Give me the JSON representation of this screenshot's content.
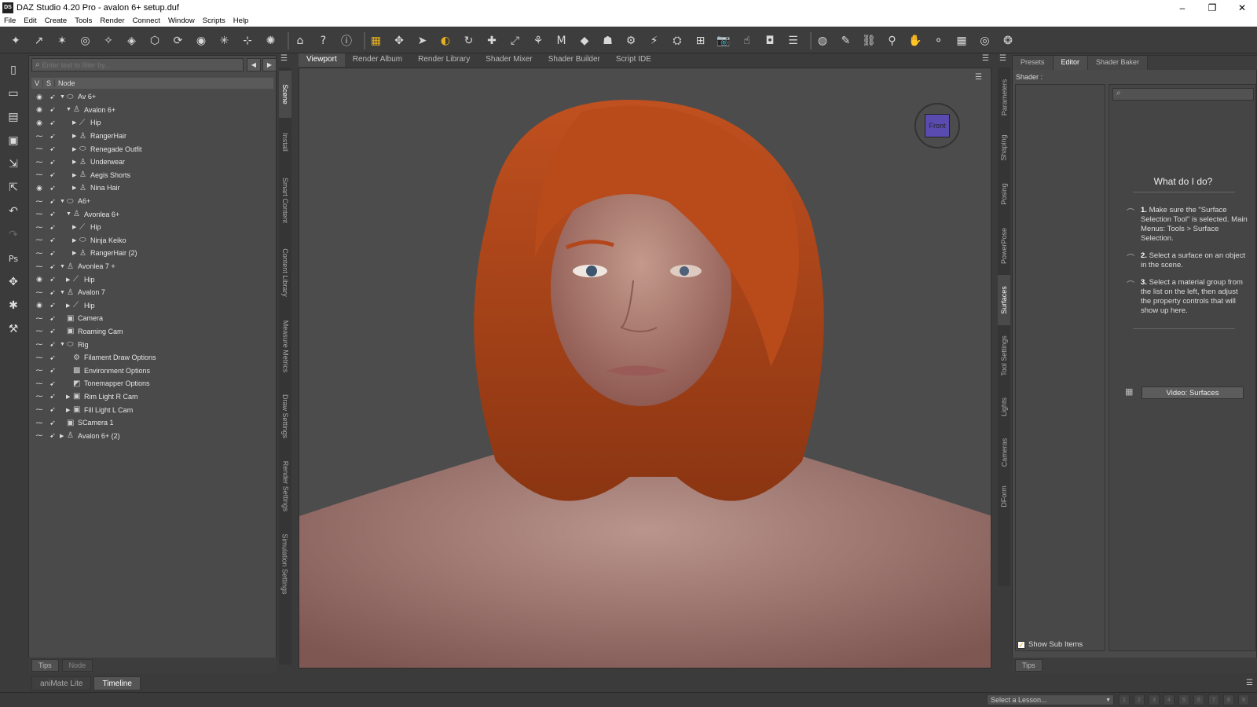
{
  "window": {
    "title": "DAZ Studio 4.20 Pro - avalon 6+ setup.duf",
    "app_badge": "DS",
    "minimize": "–",
    "restore": "❐",
    "close": "✕"
  },
  "menu": [
    "File",
    "Edit",
    "Create",
    "Tools",
    "Render",
    "Connect",
    "Window",
    "Scripts",
    "Help"
  ],
  "toolbar": {
    "icons": [
      "new-figure-icon",
      "joint-editor-icon",
      "node-weight-icon",
      "surface-selection-icon",
      "geometry-editor-icon",
      "move-tool-icon",
      "rotate-tool-icon",
      "scale-tool-icon",
      "universal-tool-icon",
      "node-selection-icon",
      "active-pose-icon",
      "weight-map-icon",
      "ds-logo-icon",
      "whats-this-icon",
      "help-icon",
      "spot-render-icon",
      "universal-manipulator-icon",
      "selection-arrow-icon",
      "pose-tool-icon",
      "rotate-icon",
      "translate-icon",
      "scale-icon",
      "transform-icon",
      "region-navigator-icon",
      "geometry-icon",
      "node-icon",
      "bone-icon",
      "erase-icon",
      "smooth-icon",
      "paint-icon",
      "camera-icon",
      "pointer-icon",
      "render-icon",
      "align-icon",
      "loop-icon",
      "brush-icon",
      "link-icon",
      "pin-icon",
      "hand-icon",
      "grab-icon",
      "grid-icon",
      "globe-icon",
      "pose-icon"
    ]
  },
  "scene": {
    "filter_placeholder": "Enter text to filter by...",
    "col_v": "V",
    "col_s": "S",
    "col_node": "Node",
    "nodes": [
      {
        "label": "Av 6+",
        "depth": 0,
        "arrow": "▼",
        "icon": "group",
        "vis": true
      },
      {
        "label": "Avalon 6+",
        "depth": 1,
        "arrow": "▼",
        "icon": "figure",
        "vis": true
      },
      {
        "label": "Hip",
        "depth": 2,
        "arrow": "▶",
        "icon": "bone",
        "vis": true
      },
      {
        "label": "RangerHair",
        "depth": 2,
        "arrow": "▶",
        "icon": "figure",
        "vis": false
      },
      {
        "label": "Renegade Outfit",
        "depth": 2,
        "arrow": "▶",
        "icon": "group",
        "vis": false
      },
      {
        "label": "Underwear",
        "depth": 2,
        "arrow": "▶",
        "icon": "figure",
        "vis": false
      },
      {
        "label": "Aegis Shorts",
        "depth": 2,
        "arrow": "▶",
        "icon": "figure",
        "vis": false
      },
      {
        "label": "Nina Hair",
        "depth": 2,
        "arrow": "▶",
        "icon": "figure",
        "vis": true
      },
      {
        "label": "A6+",
        "depth": 0,
        "arrow": "▼",
        "icon": "group",
        "vis": false
      },
      {
        "label": "Avonlea 6+",
        "depth": 1,
        "arrow": "▼",
        "icon": "figure",
        "vis": false
      },
      {
        "label": "Hip",
        "depth": 2,
        "arrow": "▶",
        "icon": "bone",
        "vis": false
      },
      {
        "label": "Ninja Keiko",
        "depth": 2,
        "arrow": "▶",
        "icon": "group",
        "vis": false
      },
      {
        "label": "RangerHair (2)",
        "depth": 2,
        "arrow": "▶",
        "icon": "figure",
        "vis": false
      },
      {
        "label": "Avonlea 7 +",
        "depth": 0,
        "arrow": "▼",
        "icon": "figure",
        "vis": false
      },
      {
        "label": "Hip",
        "depth": 1,
        "arrow": "▶",
        "icon": "bone",
        "vis": true
      },
      {
        "label": "Avalon 7",
        "depth": 0,
        "arrow": "▼",
        "icon": "figure",
        "vis": false
      },
      {
        "label": "Hip",
        "depth": 1,
        "arrow": "▶",
        "icon": "bone",
        "vis": true
      },
      {
        "label": "Camera",
        "depth": 0,
        "arrow": "",
        "icon": "camera",
        "vis": false
      },
      {
        "label": "Roaming Cam",
        "depth": 0,
        "arrow": "",
        "icon": "camera",
        "vis": false
      },
      {
        "label": "Rig",
        "depth": 0,
        "arrow": "▼",
        "icon": "group",
        "vis": false
      },
      {
        "label": "Filament Draw Options",
        "depth": 1,
        "arrow": "",
        "icon": "options",
        "vis": false
      },
      {
        "label": "Environment Options",
        "depth": 1,
        "arrow": "",
        "icon": "environment",
        "vis": false
      },
      {
        "label": "Tonemapper Options",
        "depth": 1,
        "arrow": "",
        "icon": "tonemapper",
        "vis": false
      },
      {
        "label": "Rim Light R Cam",
        "depth": 1,
        "arrow": "▶",
        "icon": "camera",
        "vis": false
      },
      {
        "label": "Fill Light L Cam",
        "depth": 1,
        "arrow": "▶",
        "icon": "camera",
        "vis": false
      },
      {
        "label": "SCamera 1",
        "depth": 0,
        "arrow": "",
        "icon": "camera",
        "vis": false
      },
      {
        "label": "Avalon 6+ (2)",
        "depth": 0,
        "arrow": "▶",
        "icon": "figure",
        "vis": false
      }
    ],
    "footer_tabs": [
      "Tips",
      "Node"
    ]
  },
  "left_vtabs": [
    "Scene",
    "Install",
    "Smart Content",
    "Content Library",
    "Measure Metrics",
    "Draw Settings",
    "Render Settings",
    "Simulation Settings"
  ],
  "right_vtabs": [
    "Parameters",
    "Shaping",
    "Posing",
    "PowerPose",
    "Surfaces",
    "Tool Settings",
    "Lights",
    "Cameras",
    "DForm"
  ],
  "view_tabs": [
    "Viewport",
    "Render Album",
    "Render Library",
    "Shader Mixer",
    "Shader Builder",
    "Script IDE"
  ],
  "viewport": {
    "cube_label": "Front"
  },
  "surfaces": {
    "tabs": [
      "Presets",
      "Editor",
      "Shader Baker"
    ],
    "shader_label": "Shader :",
    "what_title": "What do I do?",
    "steps": [
      {
        "num": "1.",
        "text": "Make sure the \"Surface Selection Tool\" is selected. Main Menus: Tools > Surface Selection."
      },
      {
        "num": "2.",
        "text": "Select a surface on an object in the scene."
      },
      {
        "num": "3.",
        "text": "Select a material group from the list on the left, then adjust the property controls that will show up here."
      }
    ],
    "video_button": "Video: Surfaces",
    "show_sub": "Show Sub Items",
    "footer_tab": "Tips"
  },
  "bottom_tabs": [
    "aniMate Lite",
    "Timeline"
  ],
  "lesson_select": "Select a Lesson...",
  "pages": [
    "1",
    "2",
    "3",
    "4",
    "5",
    "6",
    "7",
    "8",
    "9"
  ]
}
